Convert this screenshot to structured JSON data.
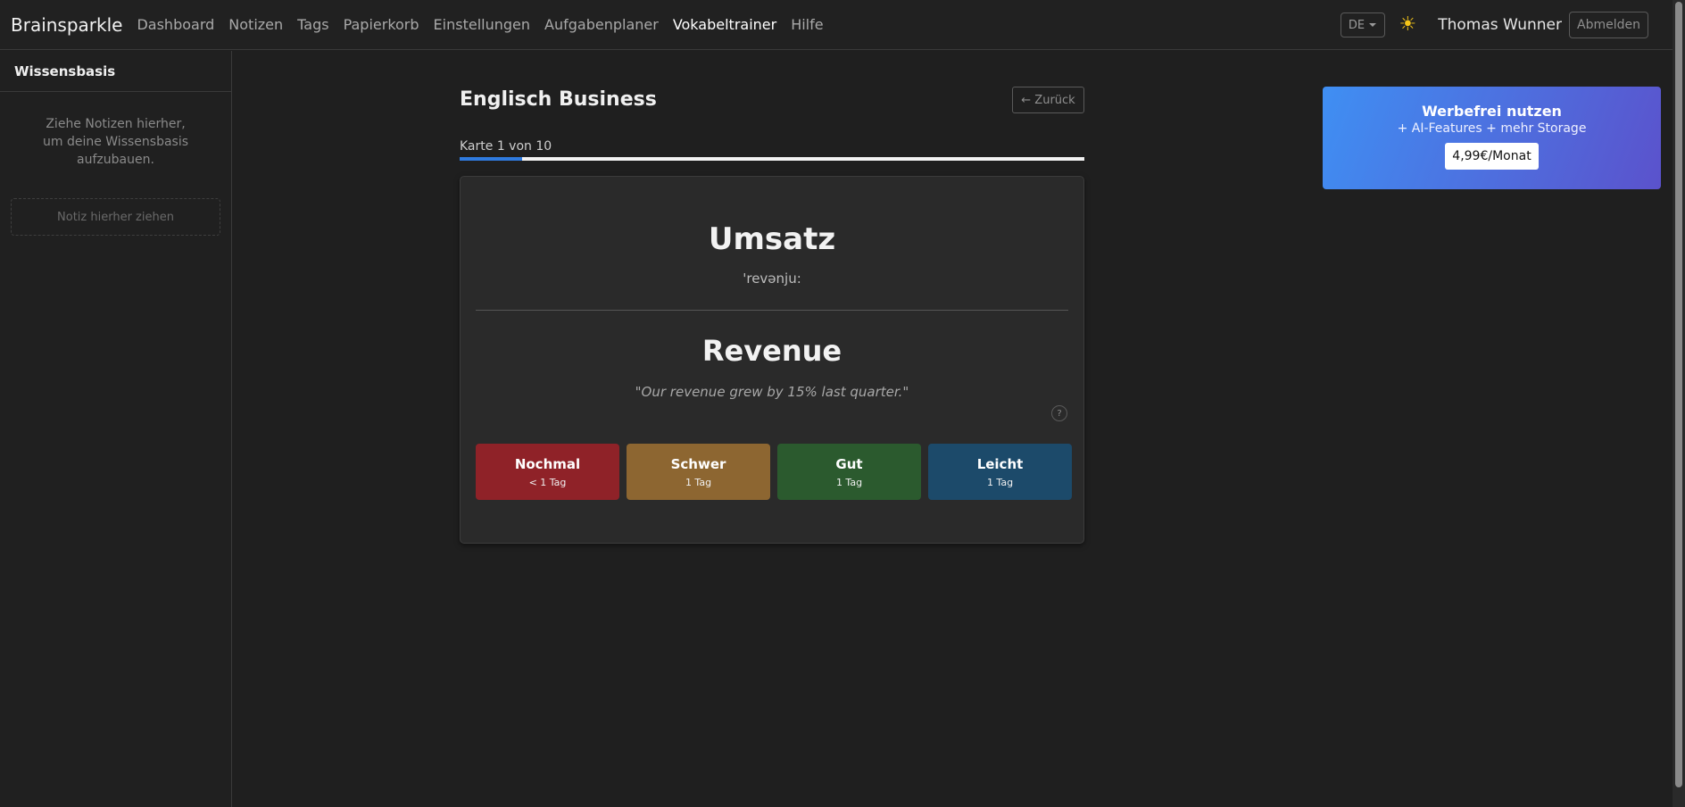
{
  "navbar": {
    "brand": "Brainsparkle",
    "links": [
      {
        "label": "Dashboard"
      },
      {
        "label": "Notizen"
      },
      {
        "label": "Tags"
      },
      {
        "label": "Papierkorb"
      },
      {
        "label": "Einstellungen"
      },
      {
        "label": "Aufgabenplaner"
      },
      {
        "label": "Vokabeltrainer",
        "active": true
      },
      {
        "label": "Hilfe"
      }
    ],
    "language": "DE",
    "theme_icon": "sun-icon",
    "user_name": "Thomas Wunner",
    "logout_label": "Abmelden"
  },
  "sidebar": {
    "title": "Wissensbasis",
    "hint": "Ziehe Notizen hierher, um deine Wissensbasis aufzubauen.",
    "dropzone_label": "Notiz hierher ziehen"
  },
  "trainer": {
    "deck_title": "Englisch Business",
    "back_label": "← Zurück",
    "progress_label": "Karte 1 von 10",
    "progress_current": 1,
    "progress_total": 10,
    "card": {
      "front": "Umsatz",
      "phonetic": "'revənju:",
      "back": "Revenue",
      "example": "\"Our revenue grew by 15% last quarter.\"",
      "help_label": "?"
    },
    "ratings": [
      {
        "label": "Nochmal",
        "interval": "< 1 Tag",
        "color": "#8f2228"
      },
      {
        "label": "Schwer",
        "interval": "1 Tag",
        "color": "#8d6631"
      },
      {
        "label": "Gut",
        "interval": "1 Tag",
        "color": "#2b5a2e"
      },
      {
        "label": "Leicht",
        "interval": "1 Tag",
        "color": "#1c4a6a"
      }
    ]
  },
  "promo": {
    "title": "Werbefrei nutzen",
    "subtitle": "+ AI-Features + mehr Storage",
    "price": "4,99€/Monat"
  },
  "colors": {
    "background": "#1f1f1f",
    "accent": "#2f7be0",
    "theme_icon": "#f5c518"
  }
}
